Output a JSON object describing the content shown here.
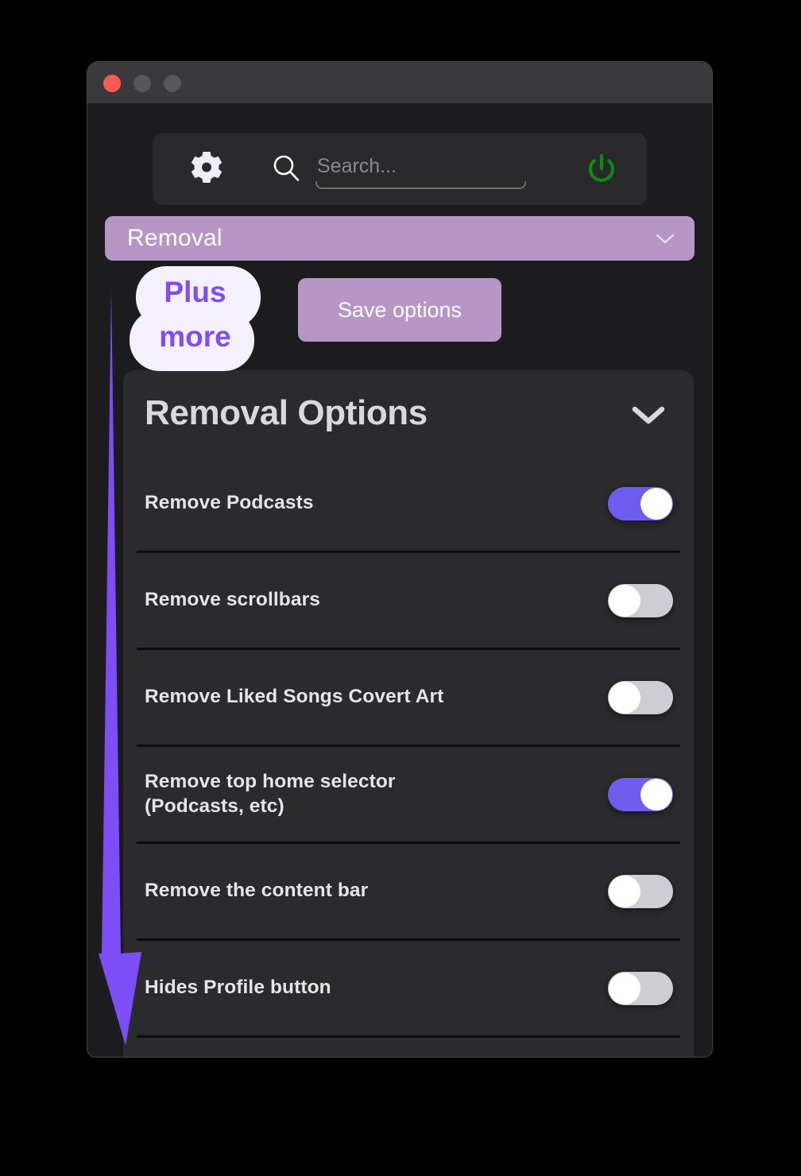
{
  "window": {
    "traffic_lights": [
      {
        "name": "close",
        "color": "#fc5b52"
      },
      {
        "name": "minimize",
        "color": "#57565c"
      },
      {
        "name": "maximize",
        "color": "#57565c"
      }
    ]
  },
  "toolbar": {
    "gear_icon": "gear-icon",
    "search_icon": "search-icon",
    "search_value": "",
    "search_placeholder": "Search...",
    "power_icon": "power-icon",
    "power_color": "#0f8a13"
  },
  "dropdown": {
    "selected": "Removal",
    "chevron_icon": "chevron-down-icon",
    "color": "#b795c5"
  },
  "actions": {
    "save_label": "Save options"
  },
  "annotations": {
    "badge_line1": "Plus",
    "badge_line2": "more",
    "badge_bg": "#f4f0fe",
    "badge_text_color": "#7d4ef5",
    "arrow_color": "#7d4ef5"
  },
  "options_card": {
    "title": "Removal Options",
    "collapse_icon": "chevron-down-icon",
    "rows": [
      {
        "label": "Remove Podcasts",
        "state": "on"
      },
      {
        "label": "Remove scrollbars",
        "state": "off"
      },
      {
        "label": "Remove Liked Songs Covert Art",
        "state": "off"
      },
      {
        "label": "Remove top home selector\n(Podcasts, etc)",
        "state": "on"
      },
      {
        "label": "Remove the content bar",
        "state": "off"
      },
      {
        "label": "Hides Profile button",
        "state": "off"
      }
    ]
  },
  "colors": {
    "window_bg": "#1c1c1e",
    "titlebar_bg": "#3a3a3c",
    "card_bg": "#2b2b2e",
    "toggle_on": "#6f5df0",
    "toggle_off": "#cfcdd4",
    "accent_mauve": "#b795c5"
  }
}
